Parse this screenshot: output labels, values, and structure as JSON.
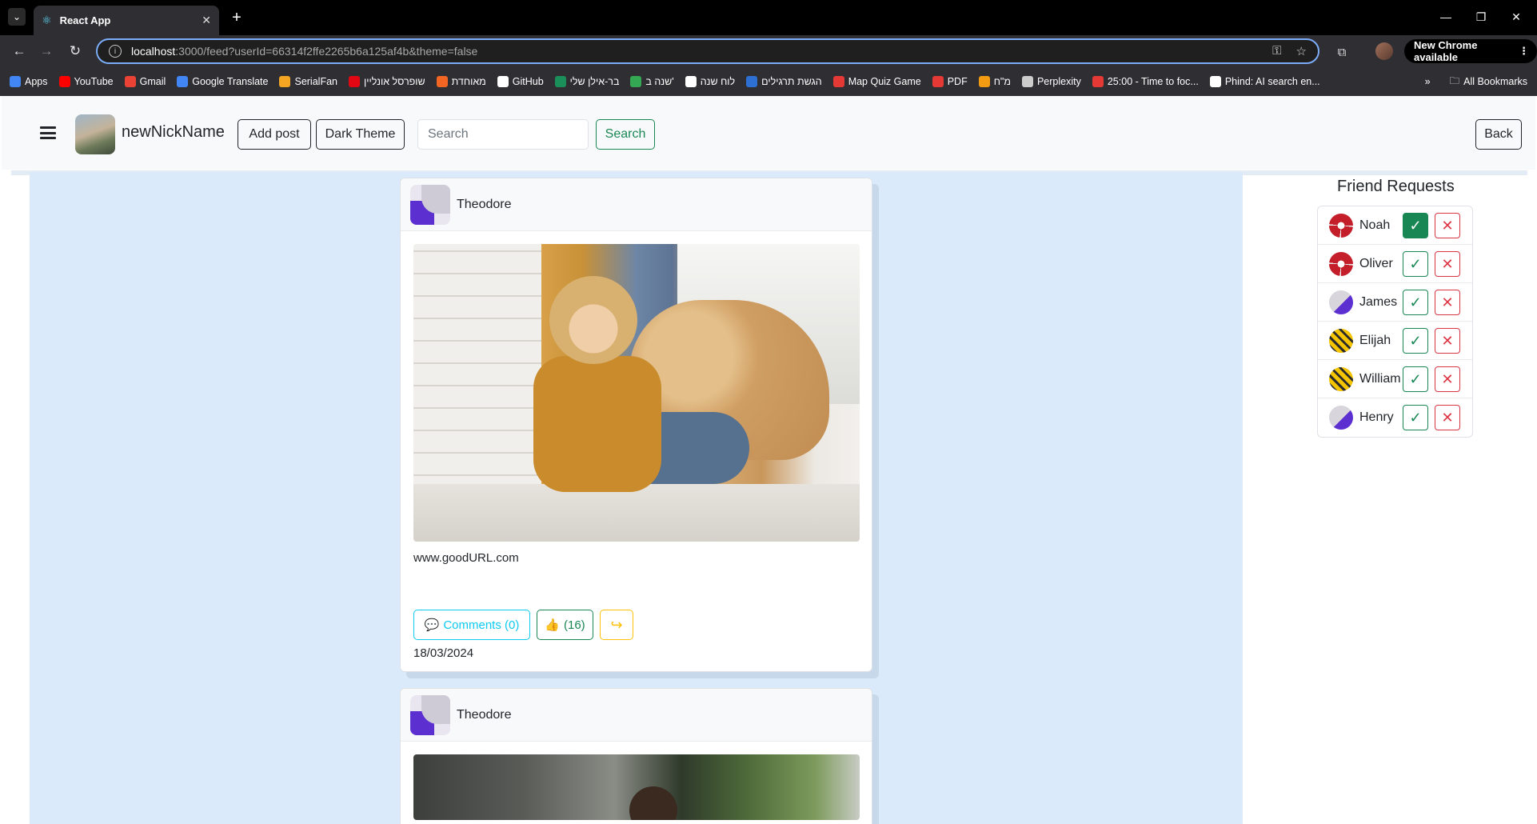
{
  "browser": {
    "tab_title": "React App",
    "url_host": "localhost",
    "url_path": ":3000/feed?userId=66314f2ffe2265b6a125af4b&theme=false",
    "new_chrome_label": "New Chrome available",
    "bookmarks": [
      {
        "label": "Apps",
        "icon_color": "#4285f4"
      },
      {
        "label": "YouTube",
        "icon_color": "#ff0000"
      },
      {
        "label": "Gmail",
        "icon_color": "#ea4335"
      },
      {
        "label": "Google Translate",
        "icon_color": "#4285f4"
      },
      {
        "label": "SerialFan",
        "icon_color": "#f5a623"
      },
      {
        "label": "שופרסל אונליין",
        "icon_color": "#e30613"
      },
      {
        "label": "מאוחדת",
        "icon_color": "#f26522"
      },
      {
        "label": "GitHub",
        "icon_color": "#ffffff"
      },
      {
        "label": "בר-אילן שלי",
        "icon_color": "#1b8f5a"
      },
      {
        "label": "שנה ב'",
        "icon_color": "#34a853"
      },
      {
        "label": "לוח שנה",
        "icon_color": "#ffffff"
      },
      {
        "label": "הגשת תרגילים",
        "icon_color": "#2d6fd2"
      },
      {
        "label": "Map Quiz Game",
        "icon_color": "#e53935"
      },
      {
        "label": "PDF",
        "icon_color": "#e53935"
      },
      {
        "label": "מ\"ח",
        "icon_color": "#f39c12"
      },
      {
        "label": "Perplexity",
        "icon_color": "#cccccc"
      },
      {
        "label": "25:00 - Time to foc...",
        "icon_color": "#e53935"
      },
      {
        "label": "Phind: AI search en...",
        "icon_color": "#ffffff"
      }
    ],
    "all_bookmarks_label": "All Bookmarks"
  },
  "navbar": {
    "nickname": "newNickName",
    "add_post_label": "Add post",
    "dark_theme_label": "Dark Theme",
    "search_placeholder": "Search",
    "search_button_label": "Search",
    "back_label": "Back"
  },
  "posts": [
    {
      "author": "Theodore",
      "link": "www.goodURL.com",
      "comments_label": "Comments (0)",
      "likes_label": "(16)",
      "date": "18/03/2024"
    },
    {
      "author": "Theodore"
    }
  ],
  "friend_requests": {
    "title": "Friend Requests",
    "items": [
      {
        "name": "Noah",
        "avatar": "red"
      },
      {
        "name": "Oliver",
        "avatar": "red"
      },
      {
        "name": "James",
        "avatar": "purple"
      },
      {
        "name": "Elijah",
        "avatar": "yellow"
      },
      {
        "name": "William",
        "avatar": "yellow"
      },
      {
        "name": "Henry",
        "avatar": "purple"
      }
    ]
  },
  "colors": {
    "feed_background": "#dbeafa",
    "success": "#198754",
    "danger": "#dc3545",
    "info": "#0dcaf0",
    "warning": "#ffc107"
  }
}
